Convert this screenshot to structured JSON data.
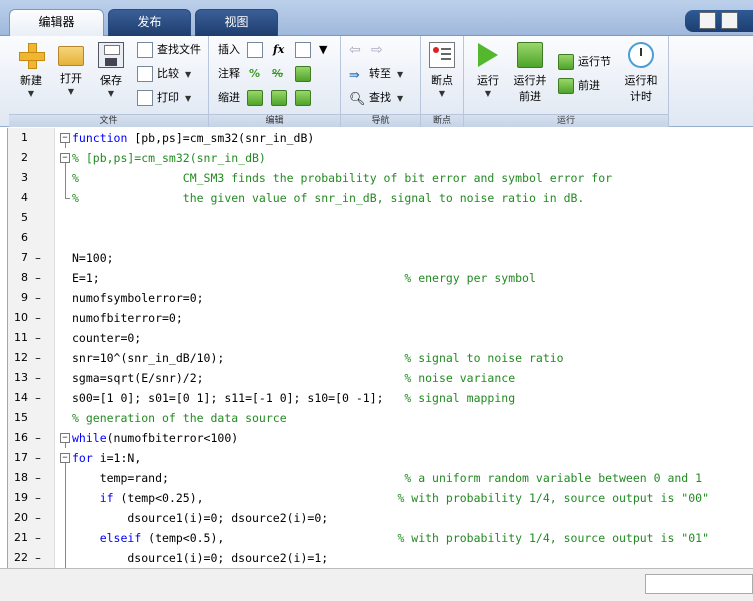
{
  "tabs": [
    {
      "label": "编辑器",
      "active": true
    },
    {
      "label": "发布",
      "active": false
    },
    {
      "label": "视图",
      "active": false
    }
  ],
  "ribbon": {
    "file_group": {
      "label": "文件",
      "new": "新建",
      "open": "打开",
      "save": "保存",
      "find_files": "查找文件",
      "compare": "比较",
      "print": "打印"
    },
    "edit_group": {
      "label": "编辑",
      "insert": "插入",
      "comment": "注释",
      "indent": "缩进",
      "fx": "fx"
    },
    "nav_group": {
      "label": "导航",
      "goto": "转至",
      "find": "查找"
    },
    "breakpoint_group": {
      "label": "断点",
      "breakpoints": "断点"
    },
    "run_group": {
      "label": "运行",
      "run": "运行",
      "run_advance_1": "运行并",
      "run_advance_2": "前进",
      "run_section": "运行节",
      "advance": "前进",
      "run_time_1": "运行和",
      "run_time_2": "计时"
    }
  },
  "editor": {
    "lines": [
      {
        "n": "1",
        "dash": "",
        "fold": "minus",
        "segments": [
          {
            "t": "function",
            "c": "kw"
          },
          {
            "t": " [pb,ps]=cm_sm32(snr_in_dB)",
            "c": ""
          }
        ]
      },
      {
        "n": "2",
        "dash": "",
        "fold": "minus",
        "segments": [
          {
            "t": "% [pb,ps]=cm_sm32(snr_in_dB)",
            "c": "cm"
          }
        ]
      },
      {
        "n": "3",
        "dash": "",
        "fold": "bar",
        "segments": [
          {
            "t": "%               CM_SM3 finds the probability of bit error and symbol error for",
            "c": "cm"
          }
        ]
      },
      {
        "n": "4",
        "dash": "",
        "fold": "end",
        "segments": [
          {
            "t": "%               the given value of snr_in_dB, signal to noise ratio in dB.",
            "c": "cm"
          }
        ]
      },
      {
        "n": "5",
        "dash": "",
        "fold": "",
        "segments": []
      },
      {
        "n": "6",
        "dash": "",
        "fold": "",
        "segments": []
      },
      {
        "n": "7",
        "dash": "–",
        "fold": "",
        "segments": [
          {
            "t": "N=100;",
            "c": ""
          }
        ]
      },
      {
        "n": "8",
        "dash": "–",
        "fold": "",
        "segments": [
          {
            "t": "E=1;                                            ",
            "c": ""
          },
          {
            "t": "% energy per symbol",
            "c": "cm"
          }
        ]
      },
      {
        "n": "9",
        "dash": "–",
        "fold": "",
        "segments": [
          {
            "t": "numofsymbolerror=0;",
            "c": ""
          }
        ]
      },
      {
        "n": "10",
        "dash": "–",
        "fold": "",
        "segments": [
          {
            "t": "numofbiterror=0;",
            "c": ""
          }
        ]
      },
      {
        "n": "11",
        "dash": "–",
        "fold": "",
        "segments": [
          {
            "t": "counter=0;",
            "c": ""
          }
        ]
      },
      {
        "n": "12",
        "dash": "–",
        "fold": "",
        "segments": [
          {
            "t": "snr=10^(snr_in_dB/10);                          ",
            "c": ""
          },
          {
            "t": "% signal to noise ratio",
            "c": "cm"
          }
        ]
      },
      {
        "n": "13",
        "dash": "–",
        "fold": "",
        "segments": [
          {
            "t": "sgma=sqrt(E/snr)/2;                             ",
            "c": ""
          },
          {
            "t": "% noise variance",
            "c": "cm"
          }
        ]
      },
      {
        "n": "14",
        "dash": "–",
        "fold": "",
        "segments": [
          {
            "t": "s00=[1 0]; s01=[0 1]; s11=[-1 0]; s10=[0 -1];   ",
            "c": ""
          },
          {
            "t": "% signal mapping",
            "c": "cm"
          }
        ]
      },
      {
        "n": "15",
        "dash": "",
        "fold": "",
        "segments": [
          {
            "t": "% generation of the data source",
            "c": "cm"
          }
        ]
      },
      {
        "n": "16",
        "dash": "–",
        "fold": "minus",
        "segments": [
          {
            "t": "while",
            "c": "kw"
          },
          {
            "t": "(numofbiterror<100)",
            "c": ""
          }
        ]
      },
      {
        "n": "17",
        "dash": "–",
        "fold": "minus",
        "segments": [
          {
            "t": "for",
            "c": "kw"
          },
          {
            "t": " i=1:N,",
            "c": ""
          }
        ]
      },
      {
        "n": "18",
        "dash": "–",
        "fold": "bar",
        "segments": [
          {
            "t": "    temp=rand;                                  ",
            "c": ""
          },
          {
            "t": "% a uniform random variable between 0 and 1",
            "c": "cm"
          }
        ]
      },
      {
        "n": "19",
        "dash": "–",
        "fold": "bar",
        "segments": [
          {
            "t": "    ",
            "c": ""
          },
          {
            "t": "if",
            "c": "kw"
          },
          {
            "t": " (temp<0.25),                            ",
            "c": ""
          },
          {
            "t": "% with probability 1/4, source output is \"00\"",
            "c": "cm"
          }
        ]
      },
      {
        "n": "20",
        "dash": "–",
        "fold": "bar",
        "segments": [
          {
            "t": "        dsource1(i)=0; dsource2(i)=0;",
            "c": ""
          }
        ]
      },
      {
        "n": "21",
        "dash": "–",
        "fold": "bar",
        "segments": [
          {
            "t": "    ",
            "c": ""
          },
          {
            "t": "elseif",
            "c": "kw"
          },
          {
            "t": " (temp<0.5),                         ",
            "c": ""
          },
          {
            "t": "% with probability 1/4, source output is \"01\"",
            "c": "cm"
          }
        ]
      },
      {
        "n": "22",
        "dash": "–",
        "fold": "bar",
        "segments": [
          {
            "t": "        dsource1(i)=0; dsource2(i)=1;",
            "c": ""
          }
        ]
      }
    ]
  }
}
